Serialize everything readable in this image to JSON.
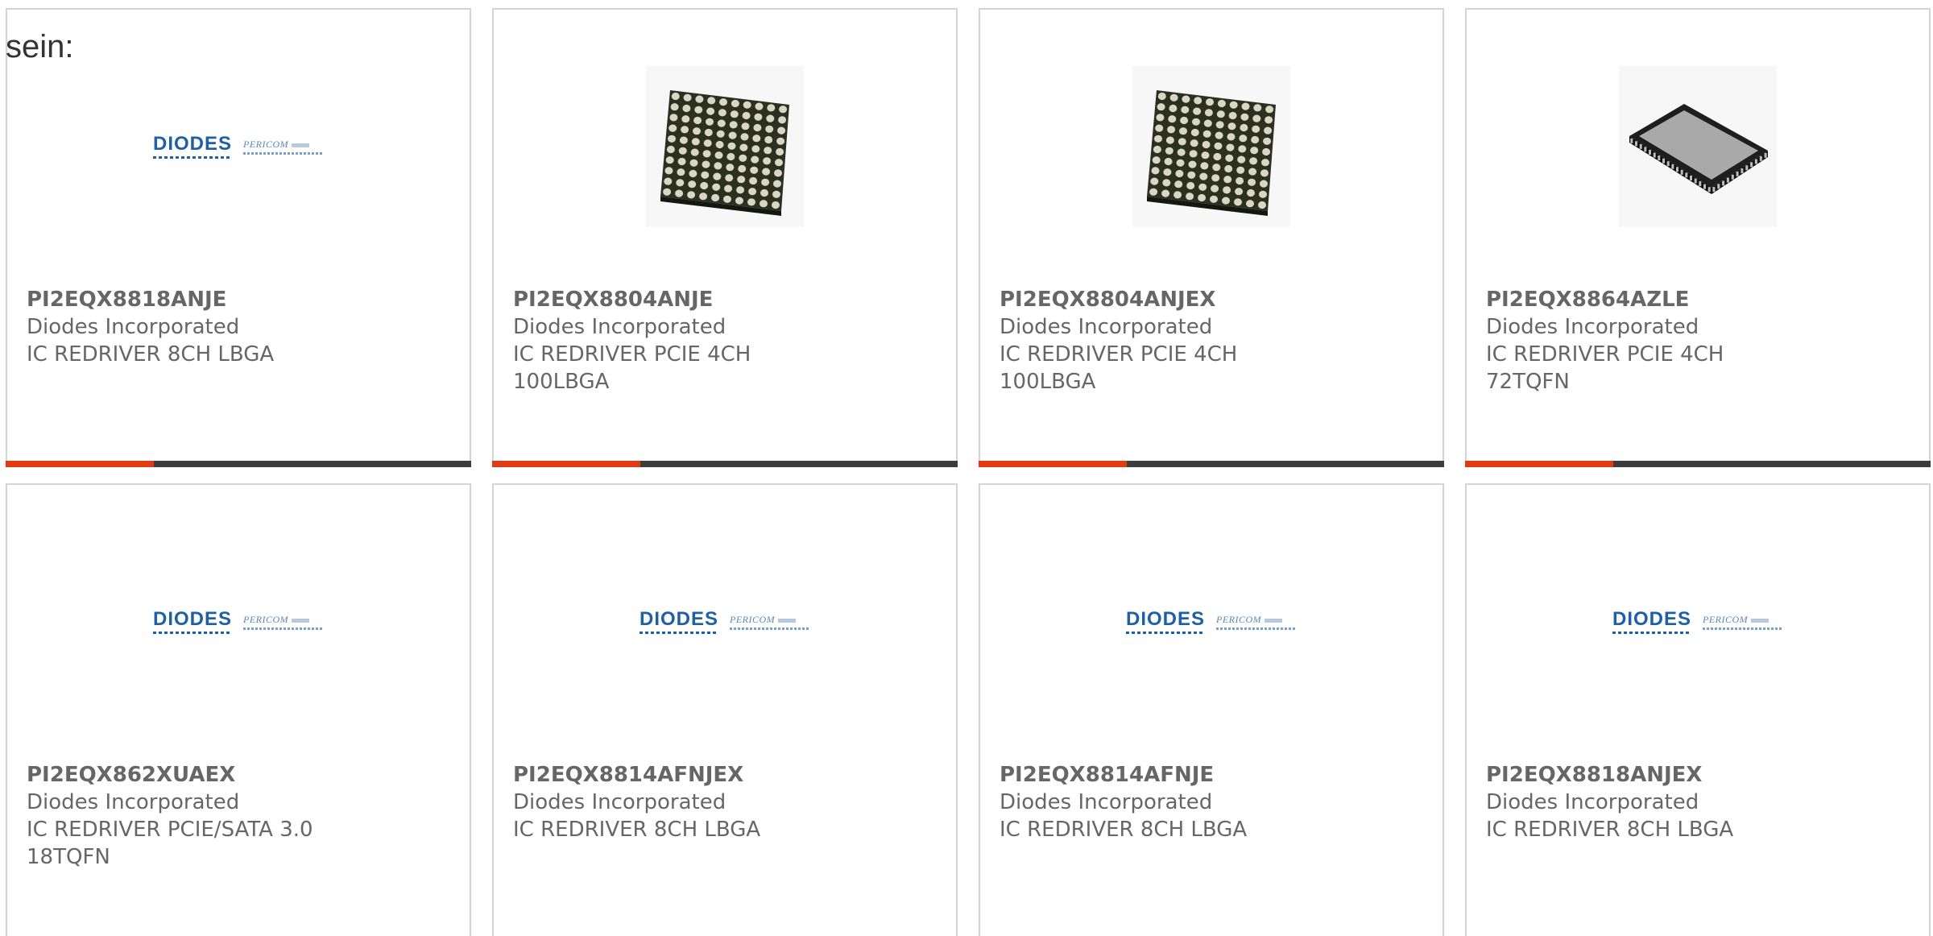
{
  "intro": {
    "text": "sein:"
  },
  "colors": {
    "card_border": "#d4d4d4",
    "text": "#666666",
    "accent_bar": "#e23a12",
    "dark_bar": "#3c3c3c",
    "logo_blue": "#1f5fa3"
  },
  "products": [
    {
      "part_number": "PI2EQX8818ANJE",
      "manufacturer": "Diodes Incorporated",
      "description": "IC REDRIVER 8CH LBGA",
      "image": "diodes-pericom-logo"
    },
    {
      "part_number": "PI2EQX8804ANJE",
      "manufacturer": "Diodes Incorporated",
      "description": "IC REDRIVER PCIE 4CH 100LBGA",
      "image": "bga-chip-photo"
    },
    {
      "part_number": "PI2EQX8804ANJEX",
      "manufacturer": "Diodes Incorporated",
      "description": "IC REDRIVER PCIE 4CH 100LBGA",
      "image": "bga-chip-photo"
    },
    {
      "part_number": "PI2EQX8864AZLE",
      "manufacturer": "Diodes Incorporated",
      "description": "IC REDRIVER PCIE 4CH 72TQFN",
      "image": "tqfn-chip-photo"
    },
    {
      "part_number": "PI2EQX862XUAEX",
      "manufacturer": "Diodes Incorporated",
      "description": "IC REDRIVER PCIE/SATA 3.0 18TQFN",
      "image": "diodes-pericom-logo"
    },
    {
      "part_number": "PI2EQX8814AFNJEX",
      "manufacturer": "Diodes Incorporated",
      "description": "IC REDRIVER 8CH LBGA",
      "image": "diodes-pericom-logo"
    },
    {
      "part_number": "PI2EQX8814AFNJE",
      "manufacturer": "Diodes Incorporated",
      "description": "IC REDRIVER 8CH LBGA",
      "image": "diodes-pericom-logo"
    },
    {
      "part_number": "PI2EQX8818ANJEX",
      "manufacturer": "Diodes Incorporated",
      "description": "IC REDRIVER 8CH LBGA",
      "image": "diodes-pericom-logo"
    }
  ],
  "logo": {
    "diodes_text": "DIODES",
    "pericom_text": "PERICOM"
  }
}
